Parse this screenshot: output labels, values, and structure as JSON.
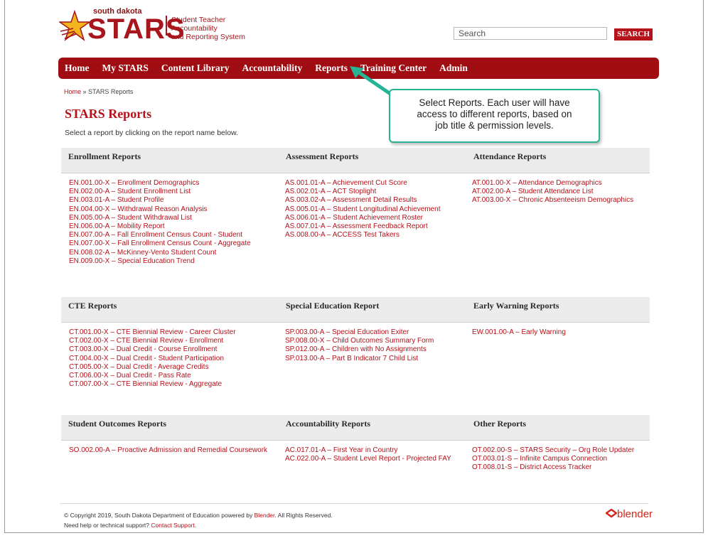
{
  "logo": {
    "top_text": "south dakota",
    "name": "STARS",
    "sub_line1": "Student Teacher Accountability",
    "sub_line2": "and Reporting System"
  },
  "search": {
    "placeholder": "Search",
    "button": "SEARCH"
  },
  "nav": [
    "Home",
    "My STARS",
    "Content Library",
    "Accountability",
    "Reports",
    "Training Center",
    "Admin"
  ],
  "breadcrumb": {
    "home": "Home",
    "sep": " » ",
    "current": "STARS Reports"
  },
  "page_title": "STARS Reports",
  "intro": "Select a report by clicking on the report name below.",
  "callout": {
    "line1": "Select Reports. Each user will have",
    "line2": "access to different reports, based on",
    "line3": "job title & permission levels."
  },
  "sections": [
    {
      "title": "Enrollment Reports",
      "items": [
        "EN.001.00-X – Enrollment Demographics",
        "EN.002.00-A – Student Enrollment List",
        "EN.003.01-A – Student Profile",
        "EN.004.00-X – Withdrawal Reason Analysis",
        "EN.005.00-A – Student Withdrawal List",
        "EN.006.00-A – Mobility Report",
        "EN.007.00-A – Fall Enrollment Census Count - Student",
        "EN.007.00-X – Fall Enrollment Census Count - Aggregate",
        "EN.008.02-A – McKinney-Vento Student Count",
        "EN.009.00-X – Special Education Trend"
      ]
    },
    {
      "title": "Assessment Reports",
      "items": [
        "AS.001.01-A – Achievement Cut Score",
        "AS.002.01-A – ACT Stoplight",
        "AS.003.02-A – Assessment Detail Results",
        "AS.005.01-A – Student Longitudinal Achievement",
        "AS.006.01-A – Student Achievement Roster",
        "AS.007.01-A – Assessment Feedback Report",
        "AS.008.00-A – ACCESS Test Takers"
      ]
    },
    {
      "title": "Attendance Reports",
      "items": [
        "AT.001.00-X – Attendance Demographics",
        "AT.002.00-A – Student Attendance List",
        "AT.003.00-X – Chronic Absenteeism Demographics"
      ]
    },
    {
      "title": "CTE Reports",
      "items": [
        "CT.001.00-X – CTE Biennial Review - Career Cluster",
        "CT.002.00-X – CTE Biennial Review - Enrollment",
        "CT.003.00-X – Dual Credit - Course Enrollment",
        "CT.004.00-X – Dual Credit - Student Participation",
        "CT.005.00-X – Dual Credit - Average Credits",
        "CT.006.00-X – Dual Credit - Pass Rate",
        "CT.007.00-X – CTE Biennial Review - Aggregate"
      ]
    },
    {
      "title": "Special Education Report",
      "items": [
        "SP.003.00-A – Special Education Exiter",
        "SP.008.00-X – Child Outcomes Summary Form",
        "SP.012.00-A – Children with No Assignments",
        "SP.013.00-A – Part B Indicator 7 Child List"
      ]
    },
    {
      "title": "Early Warning Reports",
      "items": [
        "EW.001.00-A – Early Warning"
      ]
    },
    {
      "title": "Student Outcomes Reports",
      "items": [
        "SO.002.00-A – Proactive Admission and Remedial Coursework"
      ]
    },
    {
      "title": "Accountability Reports",
      "items": [
        "AC.017.01-A – First Year in Country",
        "AC.022.00-A – Student Level Report - Projected FAY"
      ]
    },
    {
      "title": "Other Reports",
      "items": [
        "OT.002.00-S – STARS Security – Org Role Updater",
        "OT.003.01-S – Infinite Campus Connection",
        "OT.008.01-S – District Access Tracker"
      ]
    }
  ],
  "footer": {
    "copyright_prefix": "© Copyright 2019, South Dakota Department of Education powered by ",
    "blender_link": "Blender",
    "copyright_suffix": ". All Rights Reserved.",
    "help_prefix": "Need help or technical support? ",
    "support_link": "Contact Support",
    "help_suffix": ".",
    "brand": "blender"
  },
  "colors": {
    "brand_red": "#a6161c",
    "nav_red": "#9f0c12",
    "link_red": "#b5121b",
    "callout_teal": "#27b395"
  }
}
